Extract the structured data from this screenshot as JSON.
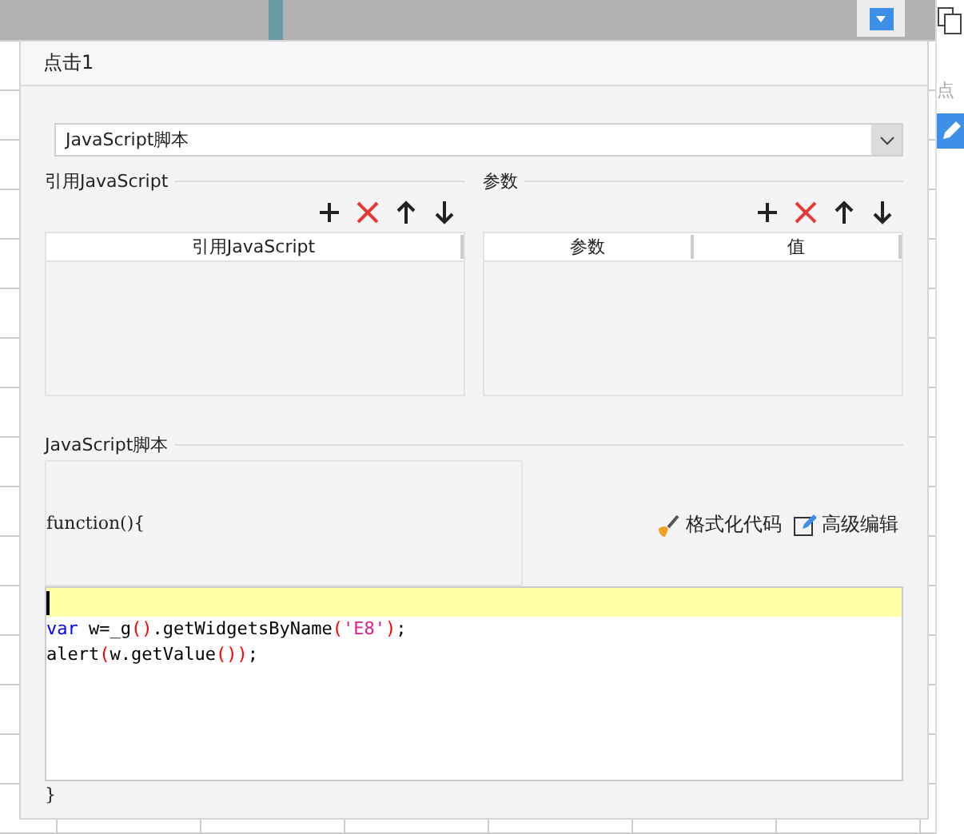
{
  "side_panel": {
    "label": "点"
  },
  "dialog": {
    "title": "点击1",
    "type_select": {
      "value": "JavaScript脚本"
    },
    "references": {
      "legend": "引用JavaScript",
      "columns": [
        "引用JavaScript"
      ]
    },
    "params": {
      "legend": "参数",
      "columns": [
        "参数",
        "值"
      ]
    },
    "script": {
      "legend": "JavaScript脚本",
      "header": "function(){",
      "actions": [
        "格式化代码",
        "高级编辑"
      ],
      "lines": [
        {
          "current": true
        },
        {
          "current": false,
          "tokens": [
            {
              "kind": "keyword",
              "text": "var"
            },
            {
              "kind": "plain",
              "text": " w=_g"
            },
            {
              "kind": "paren",
              "text": "()"
            },
            {
              "kind": "plain",
              "text": ".getWidgetsByName"
            },
            {
              "kind": "paren",
              "text": "("
            },
            {
              "kind": "string",
              "text": "'E8'"
            },
            {
              "kind": "paren",
              "text": ")"
            },
            {
              "kind": "plain",
              "text": ";"
            }
          ]
        },
        {
          "current": false,
          "tokens": [
            {
              "kind": "plain",
              "text": "alert"
            },
            {
              "kind": "paren",
              "text": "("
            },
            {
              "kind": "plain",
              "text": "w.getValue"
            },
            {
              "kind": "paren",
              "text": "())"
            },
            {
              "kind": "plain",
              "text": ";"
            }
          ]
        }
      ],
      "footer": "}"
    }
  }
}
